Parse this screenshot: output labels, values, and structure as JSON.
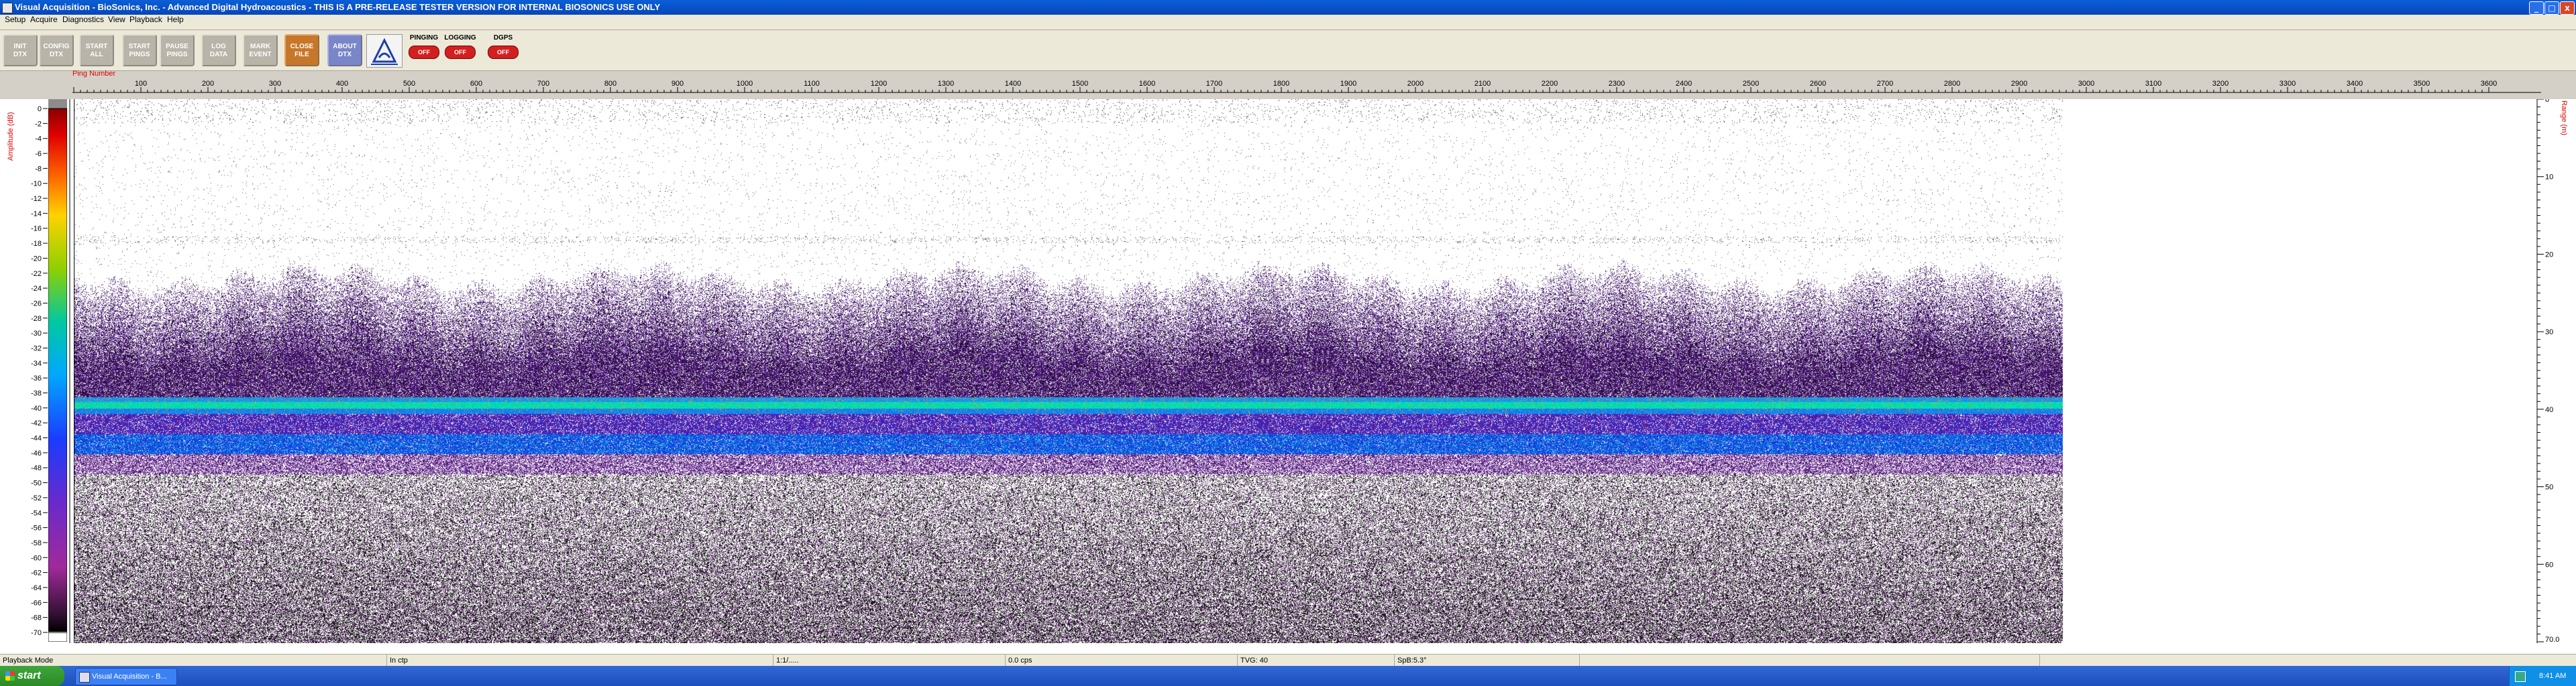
{
  "window": {
    "title": "Visual Acquisition  -  BioSonics, Inc.  -  Advanced Digital Hydroacoustics  -  THIS IS A PRE-RELEASE TESTER VERSION FOR INTERNAL BIOSONICS USE ONLY",
    "minimize": "_",
    "maximize": "□",
    "close": "x"
  },
  "menu": [
    "Setup",
    "Acquire",
    "Diagnostics",
    "View",
    "Playback",
    "Help"
  ],
  "toolbar": {
    "buttons": [
      {
        "l1": "INIT",
        "l2": "DTX"
      },
      {
        "l1": "CONFIG",
        "l2": "DTX"
      },
      {
        "l1": "START",
        "l2": "ALL"
      },
      {
        "l1": "START",
        "l2": "PINGS"
      },
      {
        "l1": "PAUSE",
        "l2": "PINGS"
      },
      {
        "l1": "LOG",
        "l2": "DATA"
      },
      {
        "l1": "MARK",
        "l2": "EVENT"
      },
      {
        "l1": "CLOSE",
        "l2": "FILE"
      },
      {
        "l1": "ABOUT",
        "l2": "DTX"
      }
    ],
    "indicators": [
      {
        "label": "PINGING",
        "state": "OFF"
      },
      {
        "label": "LOGGING",
        "state": "OFF"
      },
      {
        "label": "DGPS",
        "state": "OFF"
      }
    ],
    "logo_icon": "biosonics-logo-icon"
  },
  "ping_axis": {
    "label": "Ping Number",
    "ticks": [
      "100",
      "200",
      "300",
      "400",
      "500",
      "600",
      "700",
      "800",
      "900",
      "1000",
      "1100",
      "1200",
      "1300",
      "1400",
      "1500",
      "1600",
      "1700",
      "1800",
      "1900",
      "2000",
      "2100",
      "2200",
      "2300",
      "2400",
      "2500",
      "2600",
      "2700",
      "2800",
      "2900",
      "3000",
      "3100",
      "3200",
      "3300",
      "3400",
      "3500",
      "3600"
    ]
  },
  "amplitude_axis": {
    "label": "Amplitude (dB)",
    "ticks": [
      "0",
      "-2",
      "-4",
      "-6",
      "-8",
      "-10",
      "-12",
      "-14",
      "-16",
      "-18",
      "-20",
      "-22",
      "-24",
      "-26",
      "-28",
      "-30",
      "-32",
      "-34",
      "-36",
      "-38",
      "-40",
      "-42",
      "-44",
      "-46",
      "-48",
      "-50",
      "-52",
      "-54",
      "-56",
      "-58",
      "-60",
      "-62",
      "-64",
      "-66",
      "-68",
      "-70"
    ]
  },
  "range_axis": {
    "label": "Range (m)",
    "ticks": [
      "0",
      "10",
      "20",
      "30",
      "40",
      "50",
      "60",
      "70.0"
    ]
  },
  "status": [
    "Playback Mode",
    "In ctp",
    "1:1/.....",
    "0.0 cps",
    "TVG: 40",
    "SpB:5.3°"
  ],
  "taskbar": {
    "start": "start",
    "task": "Visual Acquisition - B...",
    "clock": "8:41 AM"
  }
}
